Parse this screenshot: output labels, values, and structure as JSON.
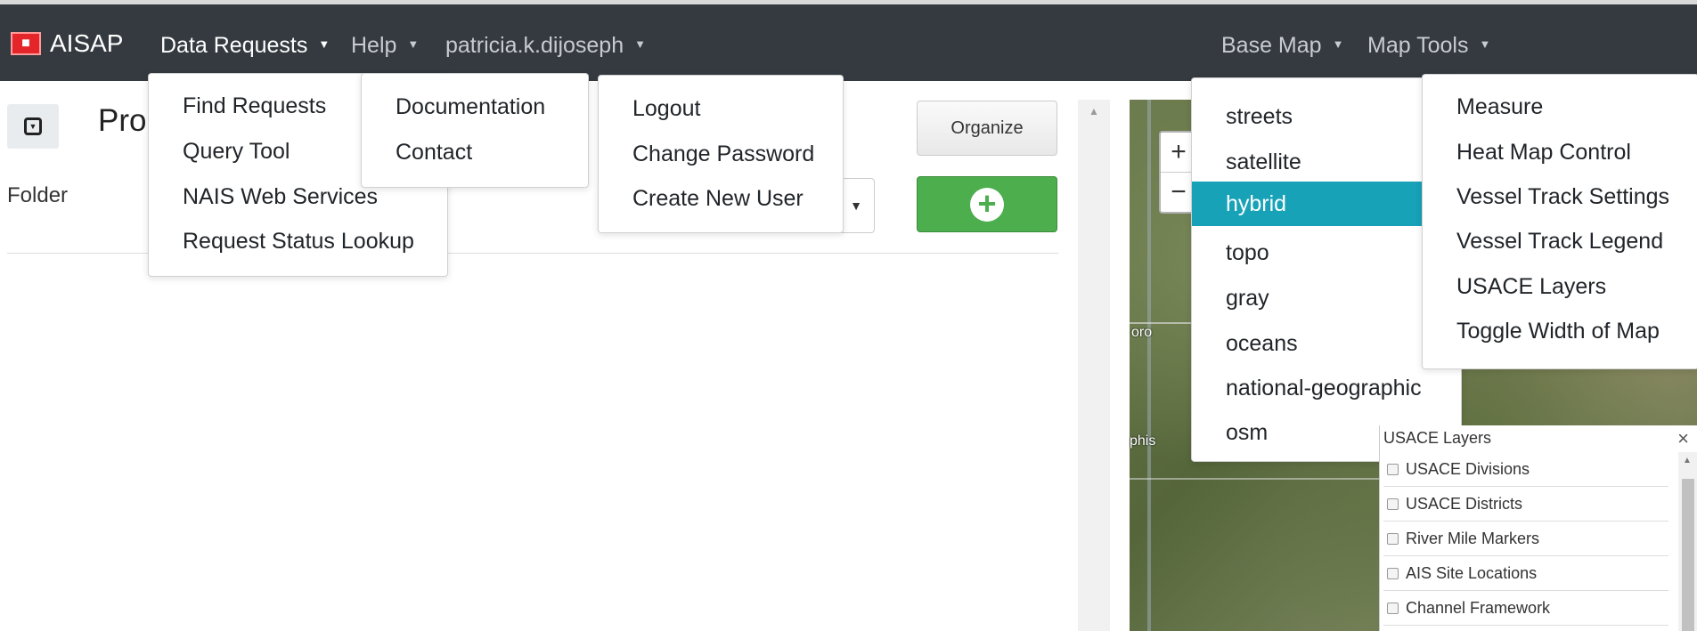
{
  "brand": {
    "logo_text": "■",
    "title": "AISAP"
  },
  "navbar": {
    "data_requests": "Data Requests",
    "help": "Help",
    "user": "patricia.k.dijoseph",
    "base_map": "Base Map",
    "map_tools": "Map Tools",
    "caret": "▼"
  },
  "data_requests_menu": [
    "Find Requests",
    "Query Tool",
    "NAIS Web Services",
    "Request Status Lookup"
  ],
  "help_menu": [
    "Documentation",
    "Contact"
  ],
  "user_menu": [
    "Logout",
    "Change Password",
    "Create New User"
  ],
  "base_map_menu": {
    "items": [
      "streets",
      "satellite",
      "hybrid",
      "topo",
      "gray",
      "oceans",
      "national-geographic",
      "osm"
    ],
    "selected": "hybrid"
  },
  "map_tools_menu": [
    "Measure",
    "Heat Map Control",
    "Vessel Track Settings",
    "Vessel Track Legend",
    "USACE Layers",
    "Toggle Width of Map"
  ],
  "left_panel": {
    "title_partial": "Pro",
    "folder_label": "Folder",
    "organize_label": "Organize",
    "add_symbol": "+",
    "select_arrow": "▼"
  },
  "map": {
    "zoom_in": "+",
    "zoom_out": "−",
    "label_1": "oro",
    "label_2": "phis"
  },
  "usace_layers": {
    "title": "USACE Layers",
    "close": "×",
    "items": [
      "USACE Divisions",
      "USACE Districts",
      "River Mile Markers",
      "AIS Site Locations",
      "Channel Framework"
    ]
  },
  "colors": {
    "navbar_bg": "#343a40",
    "active_item_bg": "#17a2b8",
    "add_button_bg": "#4cae4c",
    "brand_logo_bg": "#e4262b"
  }
}
